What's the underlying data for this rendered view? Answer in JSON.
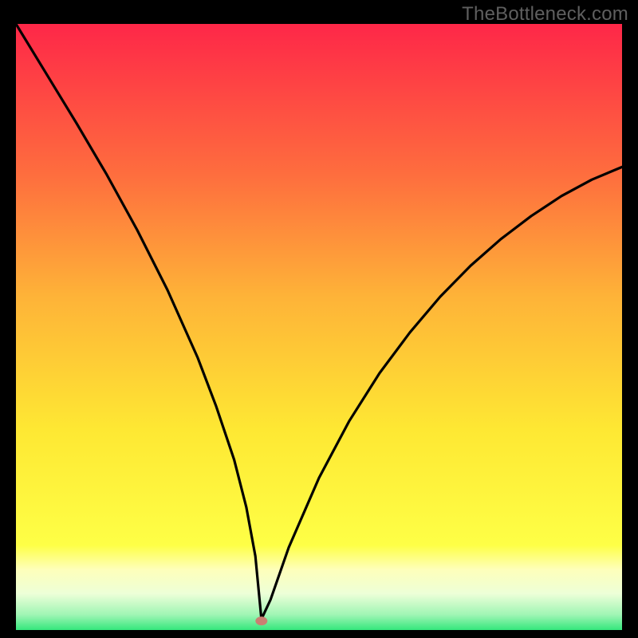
{
  "watermark": "TheBottleneck.com",
  "colors": {
    "frame_bg": "#000000",
    "curve": "#000000",
    "marker_fill": "#c97f72",
    "gradient_top": "#fe2748",
    "gradient_mid1": "#fe8f3b",
    "gradient_mid2": "#fee734",
    "gradient_band": "#feffc6",
    "gradient_green": "#34e77c"
  },
  "chart_data": {
    "type": "line",
    "title": "",
    "xlabel": "",
    "ylabel": "",
    "xlim": [
      0,
      100
    ],
    "ylim": [
      0,
      100
    ],
    "series": [
      {
        "name": "bottleneck-curve",
        "x": [
          0,
          5,
          10,
          15,
          20,
          25,
          30,
          33,
          36,
          38,
          39.5,
          40.5,
          42,
          45,
          50,
          55,
          60,
          65,
          70,
          75,
          80,
          85,
          90,
          95,
          100
        ],
        "y": [
          100,
          91.8,
          83.6,
          75.1,
          66.0,
          56.1,
          44.9,
          37.0,
          28.1,
          20.3,
          12.2,
          1.8,
          5.0,
          13.6,
          25.1,
          34.5,
          42.4,
          49.1,
          55.0,
          60.1,
          64.5,
          68.3,
          71.6,
          74.3,
          76.4
        ]
      }
    ],
    "marker": {
      "x": 40.5,
      "y": 1.5
    },
    "annotations": []
  }
}
